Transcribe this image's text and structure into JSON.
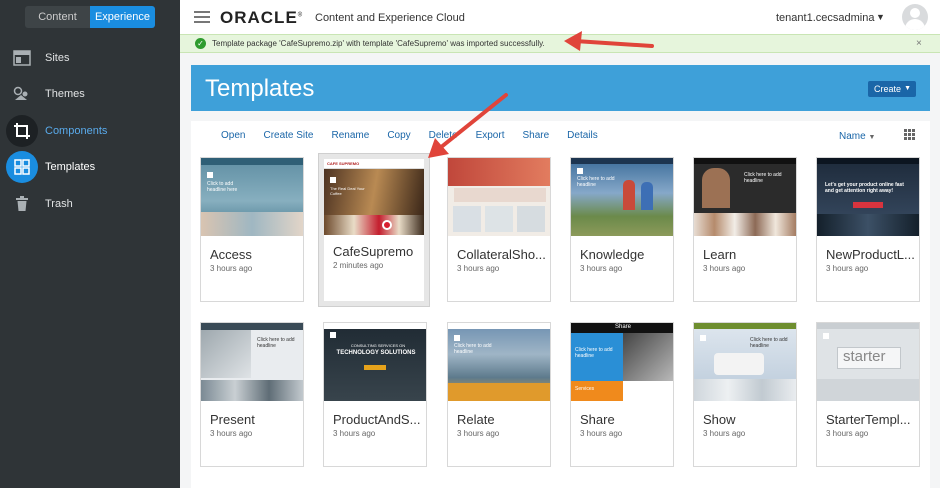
{
  "mode_toggle": {
    "content": "Content",
    "experience": "Experience"
  },
  "sidebar": {
    "items": [
      {
        "label": "Sites",
        "icon": "sites-icon"
      },
      {
        "label": "Themes",
        "icon": "themes-icon"
      },
      {
        "label": "Components",
        "icon": "components-icon"
      },
      {
        "label": "Templates",
        "icon": "templates-icon"
      },
      {
        "label": "Trash",
        "icon": "trash-icon"
      }
    ]
  },
  "header": {
    "logo": "ORACLE",
    "logo_mark": "®",
    "product": "Content and Experience Cloud",
    "user": "tenant1.cecsadmina"
  },
  "banner": {
    "message": "Template package 'CafeSupremo.zip' with template 'CafeSupremo' was imported successfully.",
    "close": "×"
  },
  "page": {
    "title": "Templates",
    "create_label": "Create"
  },
  "toolbar": {
    "actions": [
      "Open",
      "Create Site",
      "Rename",
      "Copy",
      "Delete",
      "Export",
      "Share",
      "Details"
    ],
    "sort_label": "Name"
  },
  "templates": [
    {
      "name": "Access",
      "time": "3 hours ago"
    },
    {
      "name": "CafeSupremo",
      "time": "2 minutes ago"
    },
    {
      "name": "CollateralSho...",
      "time": "3 hours ago"
    },
    {
      "name": "Knowledge",
      "time": "3 hours ago"
    },
    {
      "name": "Learn",
      "time": "3 hours ago"
    },
    {
      "name": "NewProductL...",
      "time": "3 hours ago"
    },
    {
      "name": "Present",
      "time": "3 hours ago"
    },
    {
      "name": "ProductAndS...",
      "time": "3 hours ago"
    },
    {
      "name": "Relate",
      "time": "3 hours ago"
    },
    {
      "name": "Share",
      "time": "3 hours ago"
    },
    {
      "name": "Show",
      "time": "3 hours ago"
    },
    {
      "name": "StarterTempl...",
      "time": "3 hours ago"
    }
  ],
  "thumb_text": {
    "access": "Click to add headline here",
    "cafe_brand": "CAFE SUPREMO",
    "cafe_tagline": "The Real Deal Your Coffee",
    "knowledge": "Click here to add headline",
    "learn": "Click here to add headline",
    "newproduct": "Let's get your product online fast and get attention right away!",
    "present": "Click here to add headline",
    "product_top": "CONSULTING SERVICES ON",
    "product_main": "TECHNOLOGY SOLUTIONS",
    "relate": "Click here to add headline",
    "share_title": "Share",
    "share_headline": "Click here to add headline",
    "share_services": "Services",
    "show": "Click here to add headline",
    "starter": "starter"
  },
  "colors": {
    "accent": "#1a8de0",
    "title_bar": "#3ea0d9",
    "sidebar": "#2f3437",
    "banner": "#e6f5dc",
    "arrow": "#e0443a"
  }
}
